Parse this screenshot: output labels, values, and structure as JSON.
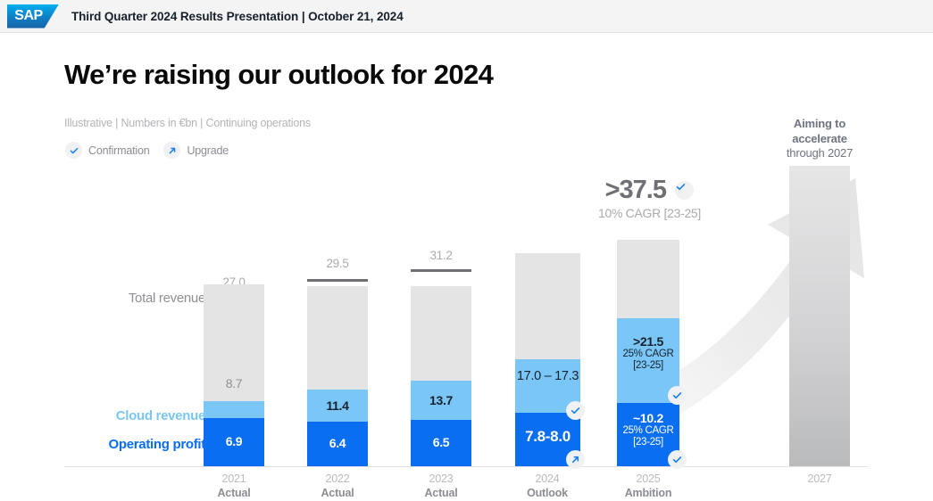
{
  "header": {
    "logo_text": "SAP",
    "logo_name": "sap-logo",
    "title": "Third Quarter 2024 Results Presentation | October 21, 2024"
  },
  "slide": {
    "title": "We’re raising our outlook for 2024",
    "subtitle": "Illustrative | Numbers in €bn | Continuing operations"
  },
  "legend": {
    "items": [
      {
        "icon": "check-icon",
        "label": "Confirmation"
      },
      {
        "icon": "arrow-up-right-icon",
        "label": "Upgrade"
      }
    ]
  },
  "category_labels": {
    "total": "Total revenue",
    "cloud": "Cloud revenue",
    "profit": "Operating profit"
  },
  "annotations": {
    "headline_2025_value": ">37.5",
    "headline_2025_sub": "10% CAGR [23-25]",
    "aiming_line1": "Aiming to",
    "aiming_line2": "accelerate",
    "aiming_line3": "through 2027"
  },
  "colors": {
    "total_revenue": "#e4e4e5",
    "cloud_revenue": "#7ac7f7",
    "operating_profit": "#0a6ef0",
    "cap_line": "#6e7075",
    "future_bar": "#c9cacc",
    "accent_blue": "#0a6ef0"
  },
  "chart_data": {
    "type": "bar",
    "title": "We’re raising our outlook for 2024",
    "subtitle": "Illustrative | Numbers in €bn | Continuing operations",
    "xlabel": "",
    "ylabel": "€bn",
    "stacked": true,
    "grid": false,
    "legend_position": "top-left",
    "ylim": [
      0,
      40
    ],
    "categories": [
      "2021",
      "2022",
      "2023",
      "2024",
      "2025",
      "2027"
    ],
    "category_sublabels": [
      "Actual",
      "Actual",
      "Actual",
      "Outlook",
      "Ambition",
      ""
    ],
    "series": [
      {
        "name": "Operating profit",
        "color": "#0a6ef0",
        "values": [
          6.9,
          6.4,
          6.5,
          7.9,
          10.2,
          null
        ],
        "labels": [
          "6.9",
          "6.4",
          "6.5",
          "7.8-8.0",
          "~10.2",
          ""
        ]
      },
      {
        "name": "Cloud revenue",
        "color": "#7ac7f7",
        "values": [
          8.7,
          11.4,
          13.7,
          17.15,
          21.5,
          null
        ],
        "labels": [
          "8.7",
          "11.4",
          "13.7",
          "17.0 – 17.3",
          ">21.5",
          ""
        ]
      },
      {
        "name": "Total revenue",
        "color": "#e4e4e5",
        "values": [
          27.0,
          29.5,
          31.2,
          34.0,
          37.5,
          41.0
        ],
        "labels": [
          "27.0",
          "29.5",
          "31.2",
          "",
          ">37.5",
          ""
        ]
      }
    ],
    "bars": [
      {
        "category": "2021",
        "sublabel": "Actual",
        "total": 27.0,
        "total_label": "27.0",
        "has_cap": true,
        "cloud": 8.7,
        "cloud_label": "8.7",
        "cloud_label_style": "gray-above",
        "profit": 6.9,
        "profit_label": "6.9",
        "badges": []
      },
      {
        "category": "2022",
        "sublabel": "Actual",
        "total": 29.5,
        "total_label": "29.5",
        "has_cap": true,
        "cloud": 11.4,
        "cloud_label": "11.4",
        "cloud_label_style": "dark-on-blue",
        "profit": 6.4,
        "profit_label": "6.4",
        "badges": []
      },
      {
        "category": "2023",
        "sublabel": "Actual",
        "total": 31.2,
        "total_label": "31.2",
        "has_cap": true,
        "cloud": 13.7,
        "cloud_label": "13.7",
        "cloud_label_style": "dark-on-blue",
        "profit": 6.5,
        "profit_label": "6.5",
        "badges": []
      },
      {
        "category": "2024",
        "sublabel": "Outlook",
        "total": 34.0,
        "total_label": "",
        "has_cap": false,
        "cloud": 17.15,
        "cloud_label": "17.0 – 17.3",
        "cloud_label_style": "dark-on-blue",
        "profit": 7.9,
        "profit_label": "7.8-8.0",
        "badges": [
          "check-icon",
          "arrow-up-right-icon"
        ]
      },
      {
        "category": "2025",
        "sublabel": "Ambition",
        "total": 37.5,
        "total_label": ">37.5",
        "has_cap": false,
        "cloud": 21.5,
        "cloud_label": ">21.5",
        "cloud_cagr": "25% CAGR",
        "cloud_cagr2": "[23-25]",
        "cloud_label_style": "dark-on-blue",
        "profit": 10.2,
        "profit_label": "~10.2",
        "profit_cagr": "25% CAGR",
        "profit_cagr2": "[23-25]",
        "badges": [
          "check-icon",
          "check-icon"
        ]
      },
      {
        "category": "2027",
        "sublabel": "",
        "total": 41.0,
        "total_label": "",
        "has_cap": false,
        "future": true,
        "badges": []
      }
    ],
    "annotations": [
      {
        "text": ">37.5",
        "sub": "10% CAGR [23-25]",
        "target": "2025",
        "position": "above-bar"
      },
      {
        "text": "Aiming to accelerate through 2027",
        "target": "2027",
        "position": "above-bar"
      }
    ]
  },
  "x_axis": [
    {
      "year": "2021",
      "sub": "Actual"
    },
    {
      "year": "2022",
      "sub": "Actual"
    },
    {
      "year": "2023",
      "sub": "Actual"
    },
    {
      "year": "2024",
      "sub": "Outlook"
    },
    {
      "year": "2025",
      "sub": "Ambition"
    },
    {
      "year": "2027",
      "sub": ""
    }
  ]
}
